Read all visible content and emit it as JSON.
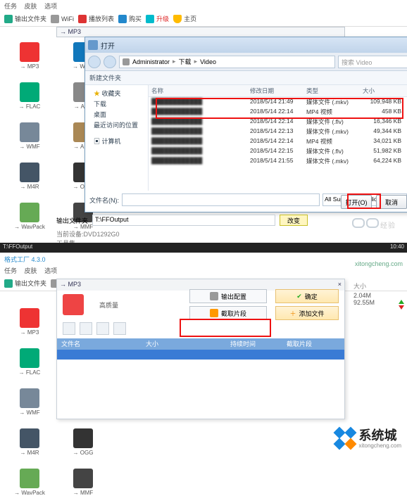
{
  "app": {
    "menu": {
      "task": "任务",
      "skin": "皮肤",
      "option": "选项"
    },
    "toolbar": {
      "outlist": "输出文件夹",
      "wifi": "WiFi",
      "playlist": "播放列表",
      "buy": "购买",
      "upgrade": "升级",
      "homepage": "主页"
    },
    "right": {
      "size_label": "大小",
      "total": "2.04M",
      "time": "92.55M"
    }
  },
  "formats": [
    {
      "code": "MP3",
      "cls": "c-mp3"
    },
    {
      "code": "WMA",
      "cls": "c-wma"
    },
    {
      "code": "FLAC",
      "cls": "c-flac"
    },
    {
      "code": "AAC",
      "cls": "c-aac"
    },
    {
      "code": "WMF",
      "cls": "c-wmf"
    },
    {
      "code": "AMR",
      "cls": "c-amr"
    },
    {
      "code": "M4R",
      "cls": "c-m4r"
    },
    {
      "code": "OGG",
      "cls": "c-ogg"
    },
    {
      "code": "WavPack",
      "cls": "c-wav"
    },
    {
      "code": "MMF",
      "cls": "c-mmf"
    }
  ],
  "mp3win": {
    "title": "→ MP3"
  },
  "open": {
    "title": "打开",
    "crumb": [
      "Administrator",
      "下载",
      "Video"
    ],
    "search_ph": "搜索 Video",
    "orgbar": "新建文件夹",
    "tree": {
      "fav": "收藏夹",
      "dl": "下载",
      "desk": "桌面",
      "recent": "最近访问的位置",
      "comp": "计算机"
    },
    "cols": {
      "name": "名称",
      "date": "修改日期",
      "type": "类型",
      "size": "大小"
    },
    "rows": [
      {
        "d": "2018/5/14 21:49",
        "t": "媒体文件 (.mkv)",
        "s": "109,948 KB"
      },
      {
        "d": "2018/5/14 22:14",
        "t": "MP4 视频",
        "s": "458 KB"
      },
      {
        "d": "2018/5/14 22:14",
        "t": "媒体文件 (.flv)",
        "s": "16,346 KB"
      },
      {
        "d": "2018/5/14 22:13",
        "t": "媒体文件 (.mkv)",
        "s": "49,344 KB"
      },
      {
        "d": "2018/5/14 22:14",
        "t": "MP4 视频",
        "s": "34,021 KB"
      },
      {
        "d": "2018/5/14 22:15",
        "t": "媒体文件 (.flv)",
        "s": "51,982 KB"
      },
      {
        "d": "2018/5/14 21:55",
        "t": "媒体文件 (.mkv)",
        "s": "64,224 KB"
      }
    ],
    "filename_label": "文件名(N):",
    "filter": "All Supported Audio&Video",
    "open_btn": "打开(O)",
    "cancel_btn": "取消"
  },
  "outbar": {
    "label": "输出文件夹",
    "value": "T:\\FFOutput",
    "change": "改变"
  },
  "meta": {
    "a": "当前设备:DVD1292G0",
    "b": "工具集"
  },
  "watermark": {
    "text": "经验"
  },
  "taskbar": {
    "left": "T:\\FFOutput",
    "right": "10:40"
  },
  "shot2": {
    "title": "格式工厂 4.3.0",
    "mp3win_title": "→ MP3",
    "quality": "高质量",
    "btn_outcfg": "输出配置",
    "btn_cut": "截取片段",
    "btn_ok": "确定",
    "btn_add": "添加文件",
    "cols": {
      "name": "文件名",
      "size": "大小",
      "dur": "持续时间",
      "cut": "截取片段"
    }
  },
  "brand": {
    "name": "系统城",
    "domain": "xitongcheng.com"
  }
}
